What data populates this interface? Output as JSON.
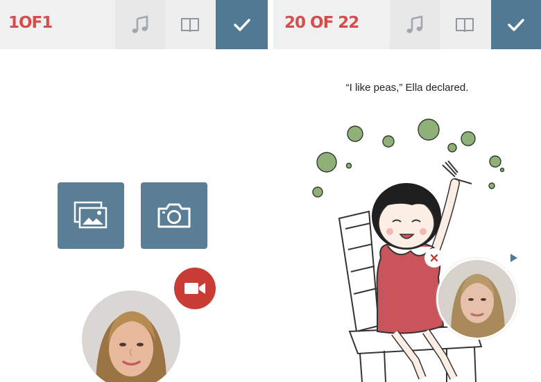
{
  "left_screen": {
    "page_counter": "1OF1",
    "toolbar": {
      "music_icon": "music-note-icon",
      "book_icon": "book-icon",
      "done_icon": "checkmark-icon"
    },
    "actions": {
      "gallery_icon": "image-gallery-icon",
      "camera_icon": "camera-icon",
      "video_icon": "video-camera-icon"
    },
    "colors": {
      "counter": "#d84b4b",
      "action_blue": "#5a7e95",
      "done_blue": "#507a93",
      "video_red": "#c83c36"
    }
  },
  "right_screen": {
    "page_counter": "20 OF 22",
    "story_text": "“I like peas,” Ella declared.",
    "toolbar": {
      "music_icon": "music-note-icon",
      "book_icon": "book-icon",
      "done_icon": "checkmark-icon"
    },
    "controls": {
      "close_icon": "close-x-icon",
      "play_icon": "play-icon"
    }
  }
}
